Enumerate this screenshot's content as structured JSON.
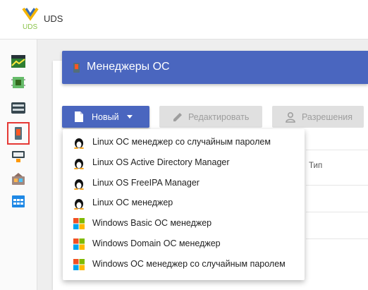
{
  "app": {
    "name": "UDS",
    "logo_text": "UDS"
  },
  "sidebar": {
    "items": [
      {
        "icon": "dashboard-chart-icon"
      },
      {
        "icon": "circuit-board-icon"
      },
      {
        "icon": "server-rack-icon"
      },
      {
        "icon": "os-manager-icon",
        "active": true
      },
      {
        "icon": "network-transport-icon"
      },
      {
        "icon": "gallery-icon"
      },
      {
        "icon": "calendar-icon"
      }
    ]
  },
  "page": {
    "title": "Менеджеры ОС"
  },
  "toolbar": {
    "new_label": "Новый",
    "edit_label": "Редактировать",
    "permissions_label": "Разрешения"
  },
  "table": {
    "type_header": "Тип"
  },
  "new_menu": {
    "items": [
      {
        "label": "Linux ОС менеджер со случайным паролем",
        "icon": "linux-tux-icon"
      },
      {
        "label": "Linux OS Active Directory Manager",
        "icon": "linux-tux-icon"
      },
      {
        "label": "Linux OS FreeIPA Manager",
        "icon": "linux-tux-icon"
      },
      {
        "label": "Linux ОС менеджер",
        "icon": "linux-tux-icon"
      },
      {
        "label": "Windows Basic ОС менеджер",
        "icon": "windows-logo-icon"
      },
      {
        "label": "Windows Domain ОС менеджер",
        "icon": "windows-logo-icon"
      },
      {
        "label": "Windows ОС менеджер со случайным паролем",
        "icon": "windows-logo-icon"
      }
    ]
  },
  "colors": {
    "primary": "#4a66bf",
    "active_outline": "#e53935",
    "disabled_button": "#e0e0e0"
  }
}
